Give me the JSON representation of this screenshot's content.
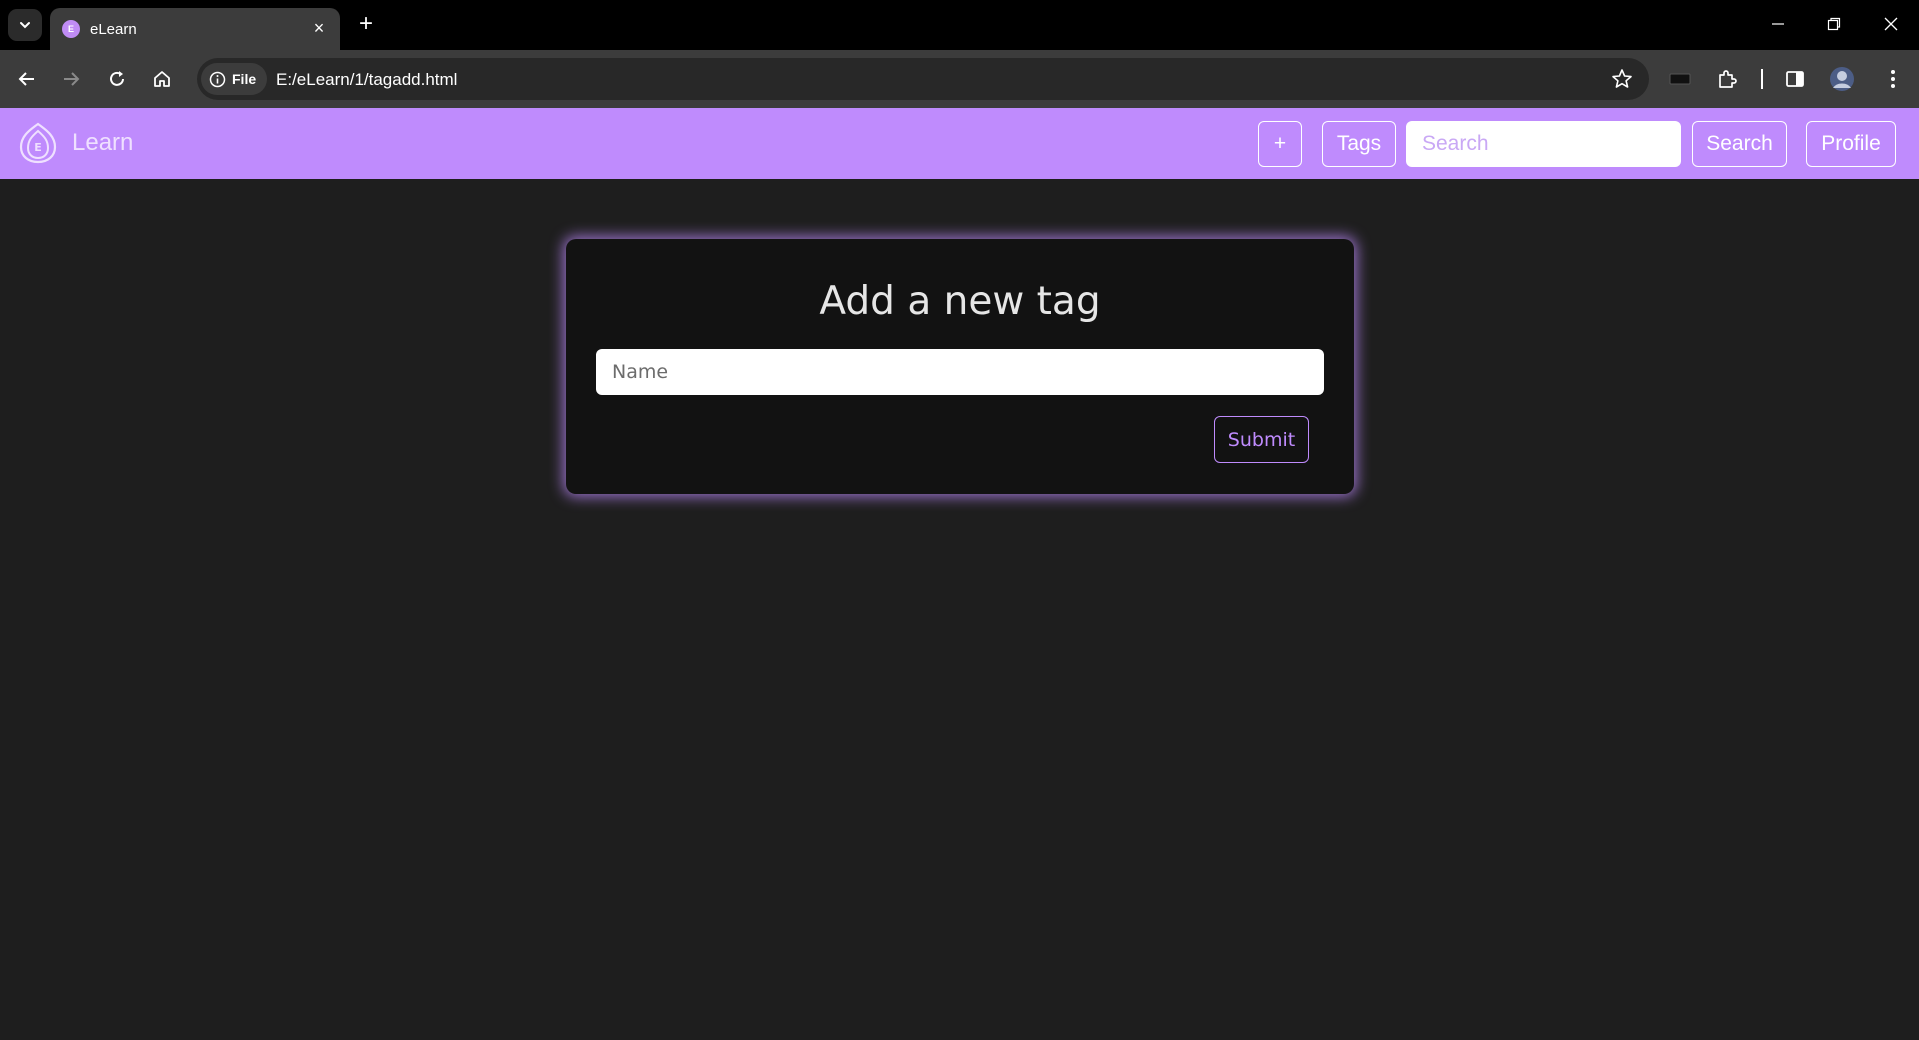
{
  "browser": {
    "tab": {
      "title": "eLearn",
      "favicon_letter": "E"
    },
    "site_chip": "File",
    "url": "E:/eLearn/1/tagadd.html"
  },
  "navbar": {
    "brand": "Learn",
    "brand_logo_letter": "E",
    "add_label": "+",
    "tags_label": "Tags",
    "search_placeholder": "Search",
    "search_button_label": "Search",
    "profile_label": "Profile"
  },
  "form": {
    "title": "Add a new tag",
    "name_placeholder": "Name",
    "submit_label": "Submit"
  },
  "colors": {
    "accent": "#bf8bfd",
    "page_bg": "#1e1e1e",
    "card_bg": "#121212"
  }
}
